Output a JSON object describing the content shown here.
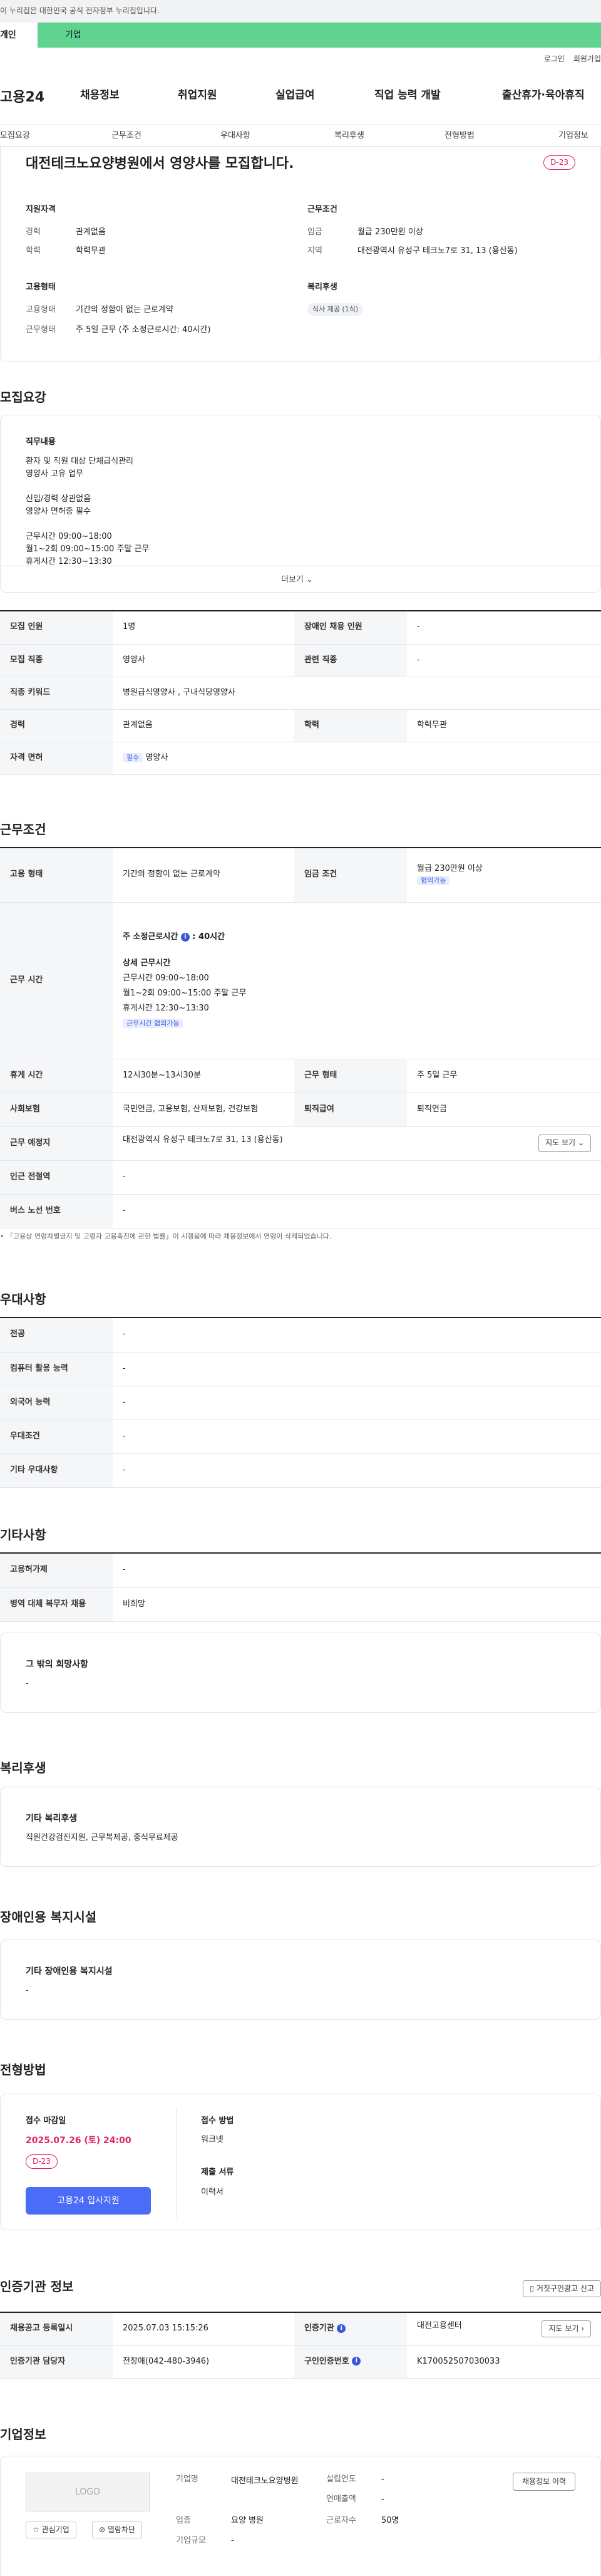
{
  "gov_banner": "이 누리집은 대한민국 공식 전자정부 누리집입니다.",
  "user_tabs": {
    "personal": "개인",
    "company": "기업"
  },
  "util": {
    "login": "로그인",
    "signup": "회원가입"
  },
  "logo": "고용24",
  "gnb": [
    "채용정보",
    "취업지원",
    "실업급여",
    "직업 능력 개발",
    "출산휴가·육아휴직"
  ],
  "anchors": [
    "모집요강",
    "근무조건",
    "우대사항",
    "복리후생",
    "전형방법",
    "기업정보"
  ],
  "summary": {
    "title": "대전테크노요양병원에서 영양사를 모집합니다.",
    "dday": "D-23",
    "qual_title": "지원자격",
    "qual": [
      {
        "k": "경력",
        "v": "관계없음"
      },
      {
        "k": "학력",
        "v": "학력무관"
      }
    ],
    "cond_title": "근무조건",
    "cond": [
      {
        "k": "임금",
        "v": "월급 230만원 이상"
      },
      {
        "k": "지역",
        "v": "대전광역시 유성구 테크노7로 31, 13 (용산동)"
      }
    ],
    "emp_title": "고용형태",
    "emp": [
      {
        "k": "고용형태",
        "v": "기간의 정함이 없는 근로계약"
      },
      {
        "k": "근무형태",
        "v": "주 5일 근무 (주 소정근로시간: 40시간)"
      }
    ],
    "welfare_title": "복리후생",
    "welfare_chip": "식사 제공 (1식)"
  },
  "recruit": {
    "title": "모집요강",
    "duty_title": "직무내용",
    "duty_lines": [
      "환자 및 직원 대상 단체급식관리",
      "영양사 고유 업무",
      "",
      "신입/경력 상관없음",
      "영양사 면허증 필수",
      "",
      "근무시간 09:00~18:00",
      "월1~2회 09:00~15:00 주말 근무",
      "휴게시간 12:30~13:30"
    ],
    "more": "더보기",
    "rows": [
      {
        "k1": "모집 인원",
        "v1": "1명",
        "k2": "장애인 채용 인원",
        "v2": "-"
      },
      {
        "k1": "모집 직종",
        "v1": "영양사",
        "k2": "관련 직종",
        "v2": "-"
      },
      {
        "k1": "직종 키워드",
        "v1": "병원급식영양사 , 구내식당영양사"
      },
      {
        "k1": "경력",
        "v1": "관계없음",
        "k2": "학력",
        "v2": "학력무관"
      },
      {
        "k1": "자격 면허",
        "badge": "필수",
        "v1": "영양사"
      }
    ]
  },
  "work": {
    "title": "근무조건",
    "emp_k": "고용 형태",
    "emp_v": "기간의 정함이 없는 근로계약",
    "wage_k": "임금 조건",
    "wage_v": "월급 230만원 이상",
    "wage_chip": "협의가능",
    "time_k": "근무 시간",
    "time_main": "주 소정근로시간",
    "time_hours": "40시간",
    "time_detail_title": "상세 근무시간",
    "time_lines": [
      "근무시간 09:00~18:00",
      "월1~2회 09:00~15:00 주말 근무",
      "휴게시간 12:30~13:30"
    ],
    "time_chip": "근무시간 협의가능",
    "rest_k": "휴게 시간",
    "rest_v": "12시30분~13시30분",
    "type_k": "근무 형태",
    "type_v": "주 5일 근무",
    "ins_k": "사회보험",
    "ins_v": "국민연금, 고용보험, 산재보험, 건강보험",
    "ret_k": "퇴직급여",
    "ret_v": "퇴직연금",
    "loc_k": "근무 예정지",
    "loc_v": "대전광역시 유성구 테크노7로 31, 13 (용산동)",
    "map_btn": "지도 보기",
    "sub_k": "인근 전철역",
    "sub_v": "-",
    "bus_k": "버스 노선 번호",
    "bus_v": "-",
    "note": "「고용상 연령차별금지 및 고령자 고용촉진에 관한 법률」이 시행됨에 따라 채용정보에서 연령이 삭제되었습니다."
  },
  "prefer": {
    "title": "우대사항",
    "rows": [
      {
        "k": "전공",
        "v": "-"
      },
      {
        "k": "컴퓨터 활용 능력",
        "v": "-"
      },
      {
        "k": "외국어 능력",
        "v": "-"
      },
      {
        "k": "우대조건",
        "v": "-"
      },
      {
        "k": "기타 우대사항",
        "v": "-"
      }
    ]
  },
  "etc": {
    "title": "기타사항",
    "rows": [
      {
        "k": "고용허가제",
        "v": "-"
      },
      {
        "k": "병역 대체 복무자 채용",
        "v": "비희망"
      }
    ],
    "box_title": "그 밖의 희망사항",
    "box_v": "-"
  },
  "benefit": {
    "title": "복리후생",
    "box_title": "기타 복리후생",
    "box_v": "직원건강검진지원, 근무복제공, 중식무료제공"
  },
  "disabled": {
    "title": "장애인용 복지시설",
    "box_title": "기타 장애인용 복지시설",
    "box_v": "-"
  },
  "process": {
    "title": "전형방법",
    "deadline_k": "접수 마감일",
    "deadline_v": "2025.07.26 (토) 24:00",
    "dday": "D-23",
    "apply_btn": "고용24 입사지원",
    "method_k": "접수 방법",
    "method_v": "워크넷",
    "docs_k": "제출 서류",
    "docs_v": "이력서"
  },
  "cert": {
    "title": "인증기관 정보",
    "report_btn": "거짓구인광고 신고",
    "reg_k": "채용공고 등록일시",
    "reg_v": "2025.07.03 15:15:26",
    "org_k": "인증기관",
    "org_v": "대전고용센터",
    "map_btn": "지도 보기",
    "mgr_k": "인증기관 담당자",
    "mgr_v": "전창애(042-480-3946)",
    "no_k": "구인인증번호",
    "no_v": "K170052507030033"
  },
  "company": {
    "title": "기업정보",
    "logo_ph": "LOGO",
    "fav_btn": "관심기업",
    "block_btn": "열람차단",
    "name_k": "기업명",
    "name_v": "대전테크노요양병원",
    "ind_k": "업종",
    "ind_v": "요양 병원",
    "size_k": "기업규모",
    "size_v": "-",
    "est_k": "설립연도",
    "est_v": "-",
    "rev_k": "연매출액",
    "rev_v": "-",
    "emp_k": "근로자수",
    "emp_v": "50명",
    "history_btn": "채용정보 이력"
  }
}
